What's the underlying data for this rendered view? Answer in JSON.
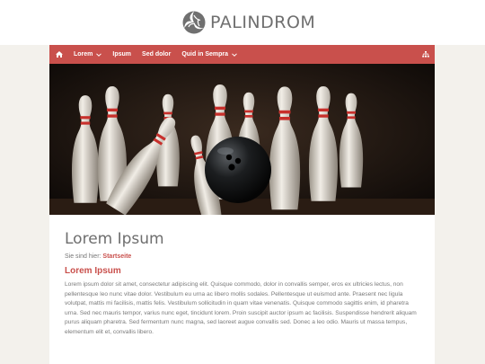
{
  "brand": {
    "name": "PALINDROM",
    "logo_icon": "triskele-ball-icon"
  },
  "nav": {
    "home_icon": "home-icon",
    "items": [
      {
        "label": "Lorem",
        "has_dropdown": true
      },
      {
        "label": "Ipsum",
        "has_dropdown": false
      },
      {
        "label": "Sed dolor",
        "has_dropdown": false
      },
      {
        "label": "Quid in Sempra",
        "has_dropdown": true
      }
    ],
    "right_icon": "sitemap-icon"
  },
  "hero": {
    "image": "bowling-pins-and-ball"
  },
  "page": {
    "title": "Lorem Ipsum",
    "breadcrumb_prefix": "Sie sind hier:",
    "breadcrumb_link": "Startseite",
    "section_heading": "Lorem Ipsum",
    "body": "Lorem ipsum dolor sit amet, consectetur adipiscing elit. Quisque commodo, dolor in convallis semper, eros ex ultricies lectus, non pellentesque leo nunc vitae dolor. Vestibulum eu urna ac libero mollis sodales. Pellentesque ut euismod ante. Praesent nec ligula volutpat, mattis mi facilisis, mattis felis. Vestibulum sollicitudin in quam vitae venenatis. Quisque commodo sagittis enim, id pharetra urna. Sed nec mauris tempor, varius nunc eget, tincidunt lorem. Proin suscipit auctor ipsum ac facilisis. Suspendisse hendrerit aliquam purus aliquam pharetra. Sed fermentum nunc magna, sed laoreet augue convallis sed. Donec a leo odio. Mauris ut massa tempus, elementum elit et, convallis libero."
  },
  "colors": {
    "accent": "#c9504c",
    "background": "#f3f1ec"
  }
}
